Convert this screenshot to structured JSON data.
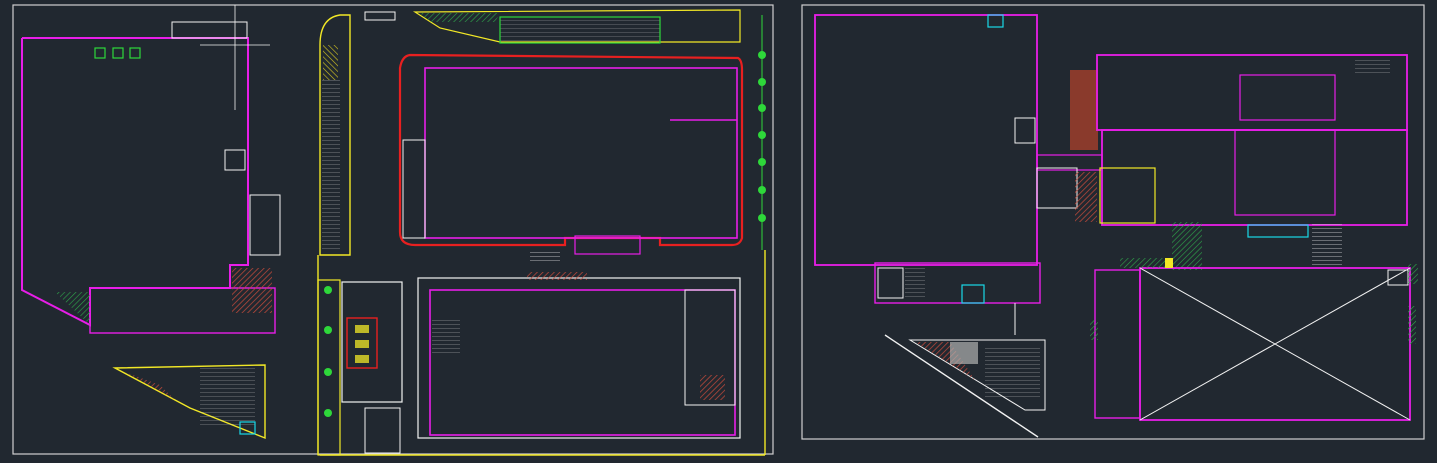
{
  "drawing": {
    "background": "#212830",
    "colors": {
      "wall": "#e81ee8",
      "frame": "#cfcfcf",
      "column": "#19d8e8",
      "yellow": "#f2e826",
      "green": "#2ed83a",
      "red": "#e82020",
      "white": "#f2f2f2",
      "brown": "#8a3a2c",
      "hatch": "#c87a3a"
    },
    "sheets": [
      {
        "id": "site-plan-left"
      },
      {
        "id": "floor-plan-right"
      }
    ]
  }
}
